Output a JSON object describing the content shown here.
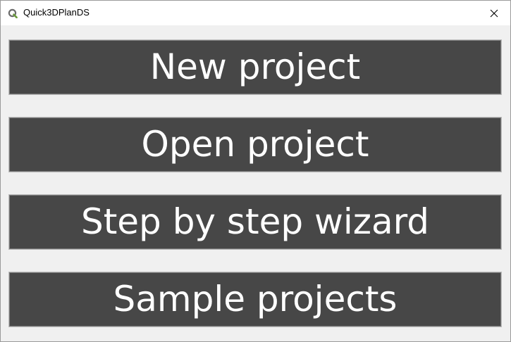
{
  "window": {
    "title": "Quick3DPlanDS",
    "accent": "#5f8a3a"
  },
  "buttons": {
    "new_project": "New project",
    "open_project": "Open project",
    "wizard": "Step by step wizard",
    "samples": "Sample projects"
  },
  "colors": {
    "button_bg": "#474747",
    "button_text": "#ffffff",
    "window_bg": "#f0f0f0"
  },
  "icons": {
    "app": "q-logo-icon",
    "close": "close-icon"
  }
}
